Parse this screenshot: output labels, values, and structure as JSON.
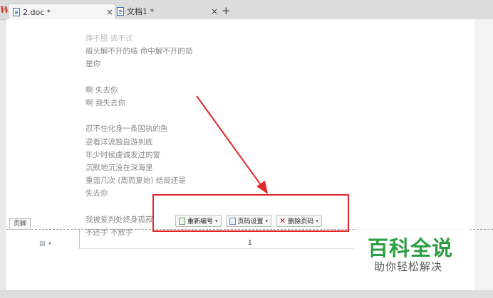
{
  "tabs": [
    {
      "label": "2.doc *",
      "active": true
    },
    {
      "label": "文档1 *",
      "active": false
    }
  ],
  "tab_close_glyph": "×",
  "new_tab_glyph": "+",
  "app_logo": "W",
  "document": {
    "lines": [
      "挣不脱  逃不过",
      "眉头解不开的结  命中解不开的劫",
      "是你",
      "",
      "啊  失去你",
      "啊  我失去你",
      "",
      "忍不住化身一条固执的鱼",
      "逆着洋流独自游到底",
      "年少时候虔诚发过的誓",
      "沉默地沉没在深海里",
      "重温几次  (周而复始)  结局还是",
      "失去你",
      "",
      "我被爱判处终身孤寂",
      "不还手  不放手"
    ]
  },
  "footer": {
    "label": "页脚",
    "page_number": "1",
    "toolbar": {
      "renumber": "重新编号",
      "page_settings": "页码设置",
      "delete_page_number": "删除页码"
    }
  },
  "watermark": {
    "title": "百科全说",
    "subtitle": "助你轻松解决"
  },
  "colors": {
    "annotation_red": "#e0282b",
    "watermark_green": "#2b9d42"
  }
}
